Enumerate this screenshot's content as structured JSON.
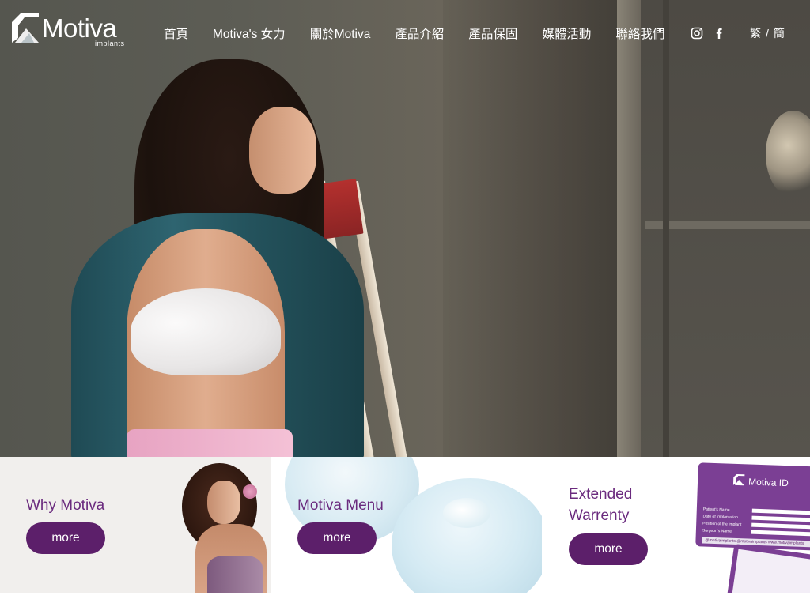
{
  "header": {
    "logo_word": "Motiva",
    "logo_sub": "implants",
    "nav": [
      "首頁",
      "Motiva's 女力",
      "關於Motiva",
      "產品介紹",
      "產品保固",
      "媒體活動",
      "聯絡我們"
    ],
    "lang_trad": "繁",
    "lang_sep": "/",
    "lang_simp": "簡"
  },
  "social": {
    "icons": [
      "instagram-icon",
      "facebook-icon"
    ]
  },
  "tiles": {
    "why": {
      "title": "Why Motiva",
      "button": "more"
    },
    "menu": {
      "title": "Motiva Menu",
      "button": "more"
    },
    "warranty": {
      "title_line1": "Extended",
      "title_line2": "Warrenty",
      "button": "more"
    }
  },
  "id_card": {
    "title": "Motiva ID",
    "fields": [
      "Patient's Name",
      "Date of implantation",
      "Position of the implant",
      "Surgeon's Name"
    ],
    "footer": "@motivaimplants   @motivaimplants   www.motivaimplants"
  },
  "colors": {
    "brand_purple": "#6a2a7e",
    "button_purple": "#5c1f6a",
    "nav_text": "#ffffff"
  }
}
